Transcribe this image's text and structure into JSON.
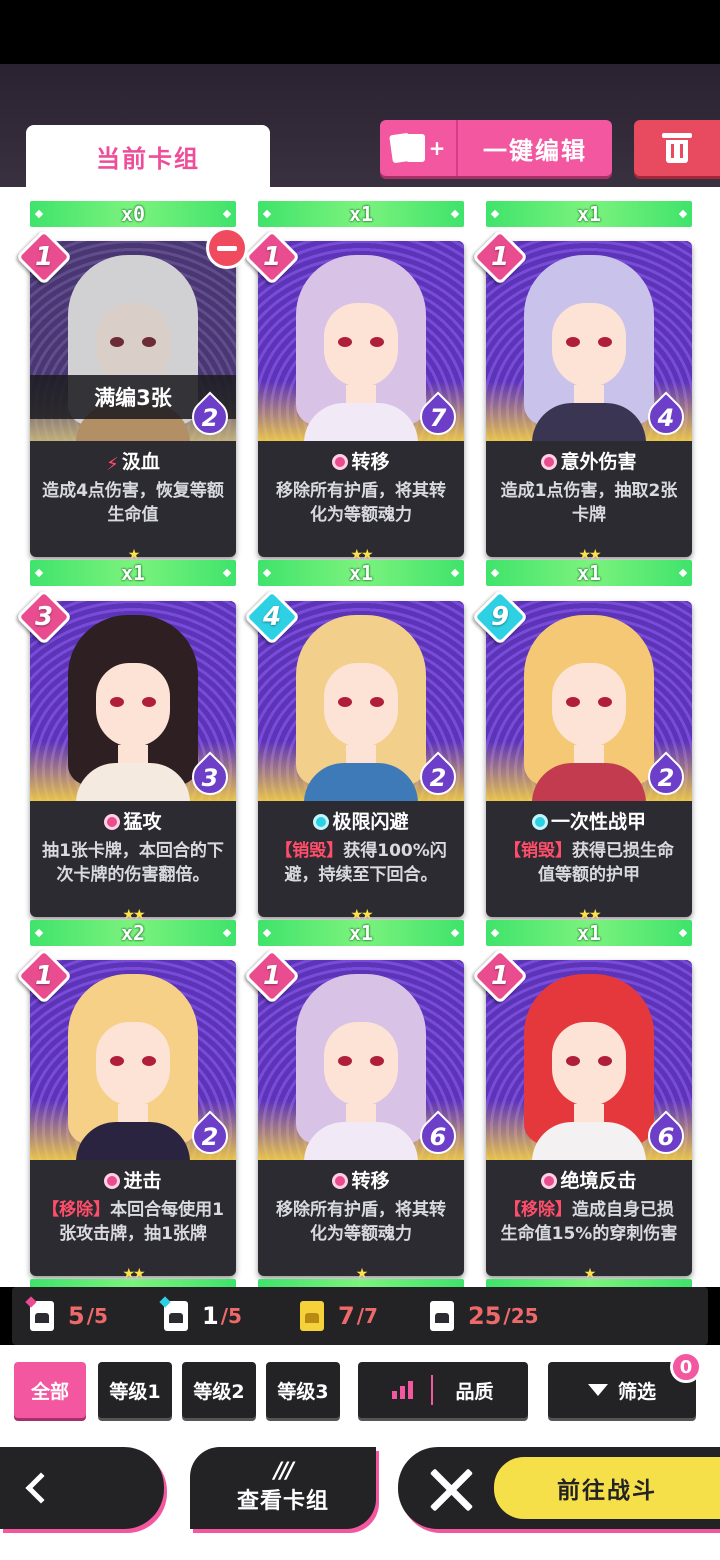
{
  "header": {
    "tab_current": "当前卡组",
    "edit_label": "一键编辑"
  },
  "cards": [
    {
      "count_top": "x0",
      "cost": "1",
      "soul": "2",
      "title": "汲血",
      "title_icon": "bolt",
      "desc": "造成4点伤害，恢复等额生命值",
      "stars": "★",
      "count_bottom": "x1",
      "overlay": "满编3张",
      "colors": {
        "hair": "#e9e6ee",
        "cloth": "#e79a3c"
      }
    },
    {
      "count_top": "x1",
      "cost": "1",
      "soul": "7",
      "title": "转移",
      "title_icon": "pink",
      "desc": "移除所有护盾，将其转化为等额魂力",
      "stars": "★★",
      "count_bottom": "x1",
      "colors": {
        "hair": "#d8c2e6",
        "cloth": "#f1e9f5"
      }
    },
    {
      "count_top": "x1",
      "cost": "1",
      "soul": "4",
      "title": "意外伤害",
      "title_icon": "pink",
      "desc": "造成1点伤害，抽取2张卡牌",
      "stars": "★★",
      "count_bottom": "x1",
      "colors": {
        "hair": "#c9c2ea",
        "cloth": "#3b3554"
      }
    },
    {
      "count_top": "",
      "cost": "3",
      "soul": "3",
      "title": "猛攻",
      "title_icon": "pink",
      "desc": "抽1张卡牌，本回合的下次卡牌的伤害翻倍。",
      "stars": "★★",
      "count_bottom": "x2",
      "colors": {
        "hair": "#2e1f22",
        "cloth": "#f4eadf"
      }
    },
    {
      "count_top": "",
      "cost": "4",
      "cost_color": "blue",
      "soul": "2",
      "title": "极限闪避",
      "title_icon": "blue",
      "tag": "【销毁】",
      "desc": "获得100%闪避，持续至下回合。",
      "stars": "★★",
      "count_bottom": "x1",
      "colors": {
        "hair": "#f2cf8a",
        "cloth": "#3f7ab8"
      }
    },
    {
      "count_top": "",
      "cost": "9",
      "cost_color": "blue",
      "soul": "2",
      "title": "一次性战甲",
      "title_icon": "blue",
      "tag": "【销毁】",
      "desc": "获得已损生命值等额的护甲",
      "stars": "★★",
      "count_bottom": "x1",
      "colors": {
        "hair": "#f4c874",
        "cloth": "#c33b4f"
      }
    },
    {
      "count_top": "",
      "cost": "1",
      "soul": "2",
      "title": "进击",
      "title_icon": "pink",
      "tag": "【移除】",
      "desc": "本回合每使用1张攻击牌，抽1张牌",
      "stars": "★★",
      "count_bottom": "",
      "colors": {
        "hair": "#f7d087",
        "cloth": "#2b2440"
      }
    },
    {
      "count_top": "",
      "cost": "1",
      "soul": "6",
      "title": "转移",
      "title_icon": "pink",
      "desc": "移除所有护盾，将其转化为等额魂力",
      "stars": "★",
      "count_bottom": "",
      "colors": {
        "hair": "#d8c2e6",
        "cloth": "#f1e9f5"
      }
    },
    {
      "count_top": "",
      "cost": "1",
      "soul": "6",
      "title": "绝境反击",
      "title_icon": "pink",
      "tag": "【移除】",
      "desc": "造成自身已损生命值15%的穿刺伤害",
      "stars": "★",
      "count_bottom": "",
      "colors": {
        "hair": "#e4383c",
        "cloth": "#f4f1f2"
      }
    }
  ],
  "stats": [
    {
      "value": "5",
      "max": "/5",
      "icon": "card-pink-icon"
    },
    {
      "value": "1",
      "max": "/5",
      "icon": "card-blue-icon"
    },
    {
      "value": "7",
      "max": "/7",
      "icon": "card-yellow-icon"
    },
    {
      "value": "25",
      "max": "/25",
      "icon": "deck-icon"
    }
  ],
  "filters": {
    "all": "全部",
    "level1": "等级1",
    "level2": "等级2",
    "level3": "等级3",
    "quality": "品质",
    "filter": "筛选",
    "filter_badge": "0"
  },
  "bottom": {
    "view_icon": "///",
    "view_label": "查看卡组",
    "fight_label": "前往战斗"
  }
}
